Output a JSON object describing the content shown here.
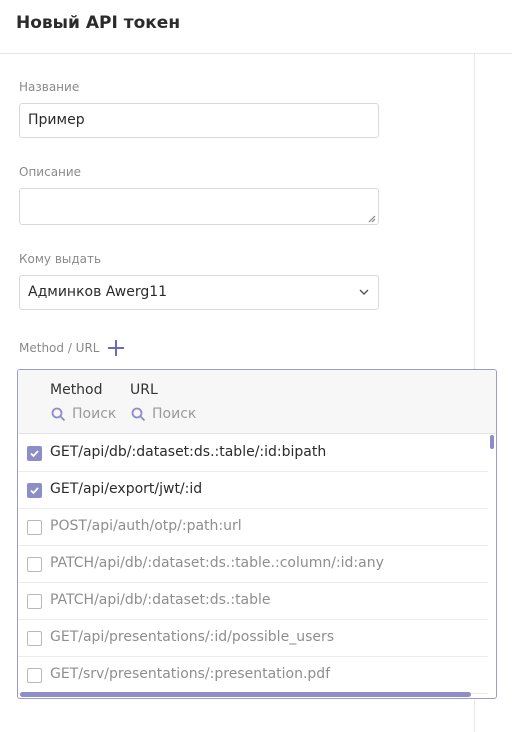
{
  "header": {
    "title": "Новый API токен"
  },
  "form": {
    "name_label": "Название",
    "name_value": "Пример",
    "description_label": "Описание",
    "description_value": "",
    "assignee_label": "Кому выдать",
    "assignee_value": "Админков Awerg11",
    "method_url_label": "Method / URL"
  },
  "table": {
    "columns": [
      "Method",
      "URL"
    ],
    "search_placeholder": "Поиск",
    "rows": [
      {
        "text": "GET/api/db/:dataset:ds.:table/:id:bipath",
        "checked": true
      },
      {
        "text": "GET/api/export/jwt/:id",
        "checked": true
      },
      {
        "text": "POST/api/auth/otp/:path:url",
        "checked": false
      },
      {
        "text": "PATCH/api/db/:dataset:ds.:table.:column/:id:any",
        "checked": false
      },
      {
        "text": "PATCH/api/db/:dataset:ds.:table",
        "checked": false
      },
      {
        "text": "GET/api/presentations/:id/possible_users",
        "checked": false
      },
      {
        "text": "GET/srv/presentations/:presentation.pdf",
        "checked": false
      }
    ]
  },
  "colors": {
    "accent": "#8d8dc9",
    "border_active": "#9c9ccc"
  }
}
